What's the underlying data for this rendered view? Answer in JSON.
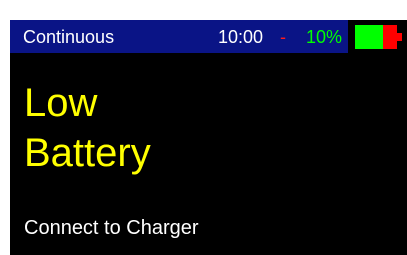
{
  "status_bar": {
    "mode": "Continuous",
    "time": "10:00",
    "separator": "-",
    "battery_percent": "10%",
    "battery_icon": "battery-low-icon",
    "background_color": "#0a1486"
  },
  "main": {
    "headline_line1": "Low",
    "headline_line2": "Battery",
    "message": "Connect to Charger"
  },
  "colors": {
    "screen_background": "#000000",
    "headline": "#ffff00",
    "message": "#ffffff",
    "percent": "#00ff00",
    "separator": "#ff1a1a",
    "battery_fill": "#00ff00",
    "battery_low_segment": "#ff0000"
  }
}
